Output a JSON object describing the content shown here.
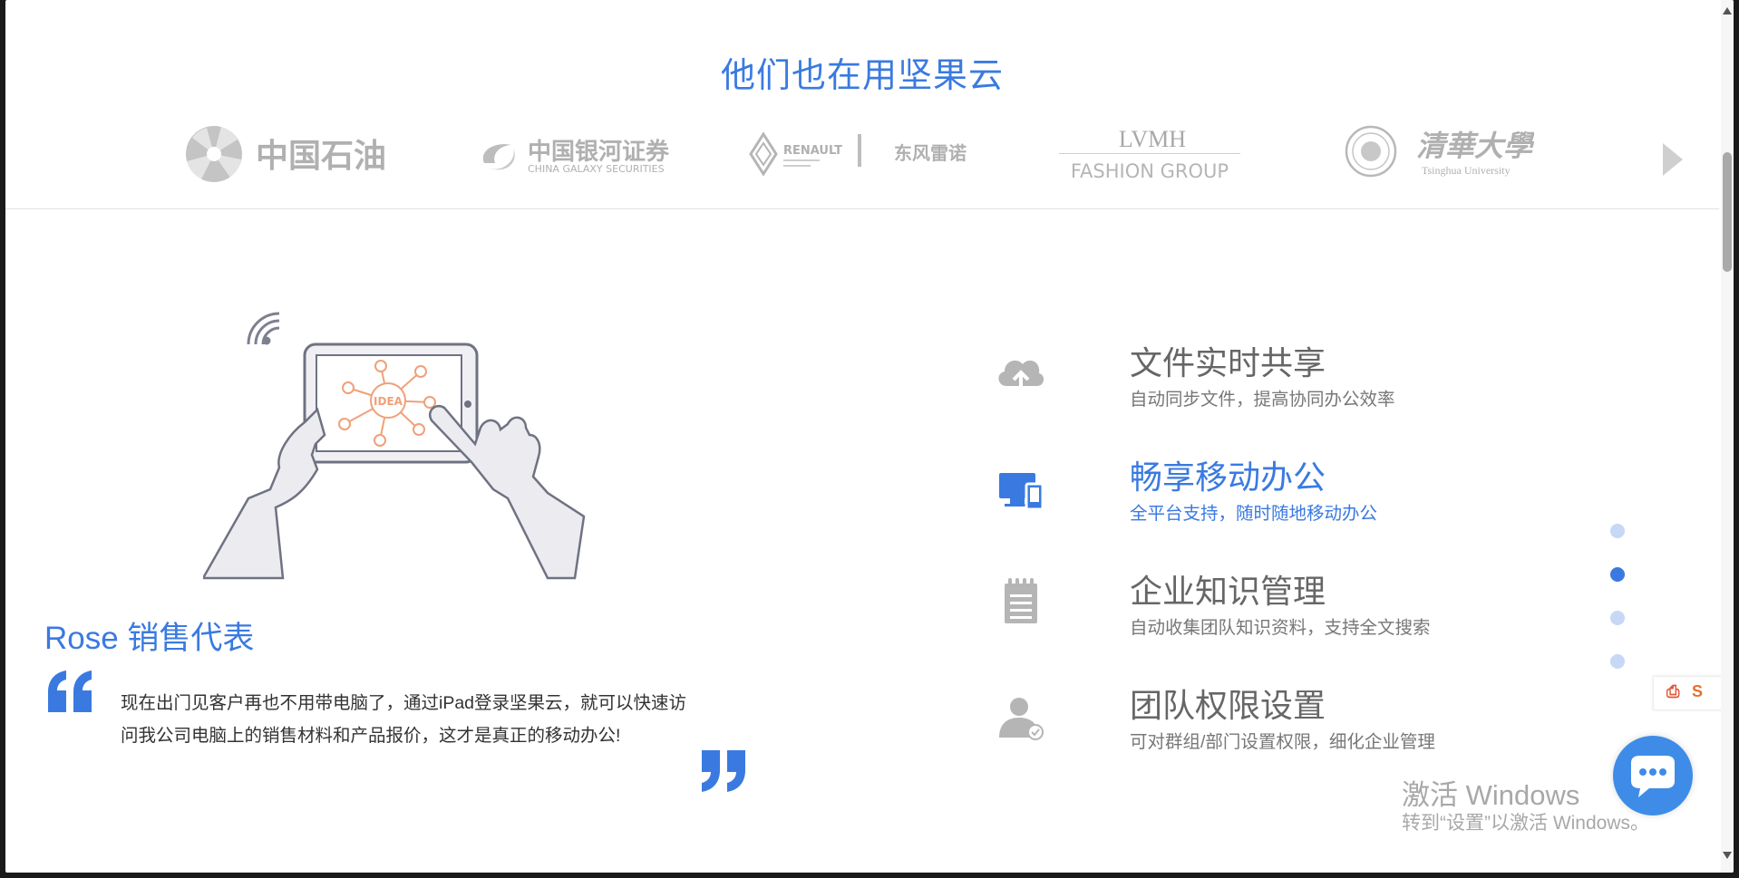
{
  "partners": {
    "title": "他们也在用坚果云",
    "logos": [
      {
        "name": "中国石油"
      },
      {
        "name": "中国银河证券",
        "sub": "CHINA GALAXY SECURITIES"
      },
      {
        "name": "RENAULT",
        "sub": "东风雷诺"
      },
      {
        "name": "LVMH",
        "sub": "FASHION GROUP"
      },
      {
        "name": "清華大學",
        "sub": "Tsinghua University"
      }
    ]
  },
  "testimonial": {
    "person": "Rose 销售代表",
    "quote_line1": "现在出门见客户再也不用带电脑了，通过iPad登录坚果云，就可以快速访",
    "quote_line2": "问我公司电脑上的销售材料和产品报价，这才是真正的移动办公!"
  },
  "features": [
    {
      "title": "文件实时共享",
      "desc": "自动同步文件，提高协同办公效率",
      "icon": "cloud-upload-icon"
    },
    {
      "title": "畅享移动办公",
      "desc": "全平台支持，随时随地移动办公",
      "icon": "devices-icon"
    },
    {
      "title": "企业知识管理",
      "desc": "自动收集团队知识资料，支持全文搜索",
      "icon": "notepad-icon"
    },
    {
      "title": "团队权限设置",
      "desc": "可对群组/部门设置权限，细化企业管理",
      "icon": "user-permission-icon"
    }
  ],
  "active_feature": 2,
  "carousel": {
    "dots": 4,
    "active_dot": 2
  },
  "watermark": {
    "line1": "激活 Windows",
    "line2": "转到“设置”以激活 Windows。"
  },
  "colors": {
    "accent": "#3a7ae0",
    "logo_gray": "#b2b2b2",
    "chat": "#3e8ce8"
  }
}
